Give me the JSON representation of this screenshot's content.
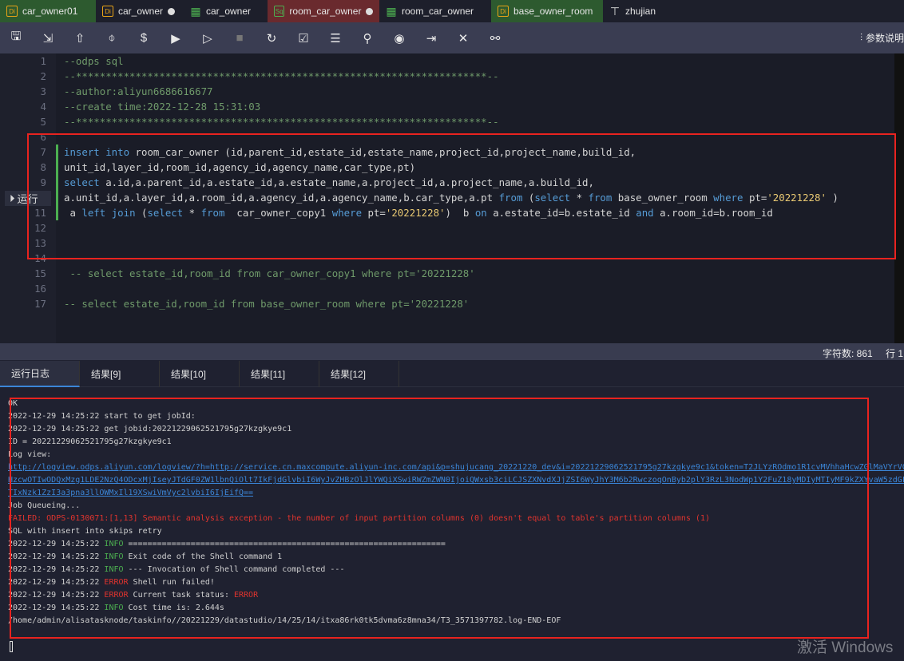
{
  "tabs": [
    {
      "label": "car_owner01",
      "icon": "Di",
      "icon_color": "#e8a317",
      "bg": "#2d5a2f",
      "dot": false
    },
    {
      "label": "car_owner",
      "icon": "Di",
      "icon_color": "#e8a317",
      "bg": "#1d1f2b",
      "dot": true
    },
    {
      "label": "car_owner",
      "icon": "table",
      "icon_color": "#4caf50",
      "bg": "#1d1f2b",
      "dot": false
    },
    {
      "label": "room_car_owner",
      "icon": "Sq",
      "icon_color": "#4caf50",
      "bg": "#6a2a2e",
      "dot": true
    },
    {
      "label": "room_car_owner",
      "icon": "table",
      "icon_color": "#4caf50",
      "bg": "#1d1f2b",
      "dot": false
    },
    {
      "label": "base_owner_room",
      "icon": "Di",
      "icon_color": "#e8a317",
      "bg": "#2d5a2f",
      "dot": false
    },
    {
      "label": "zhujian",
      "icon": "tree",
      "icon_color": "#ddd",
      "bg": "#1d1f2b",
      "dot": false
    }
  ],
  "toolbar": {
    "icons": [
      "save-icon",
      "save-as-icon",
      "submit-icon",
      "format-icon",
      "cost-icon",
      "run-icon",
      "run-params-icon",
      "stop-icon",
      "reload-icon",
      "check-icon",
      "log-icon",
      "user-icon",
      "preview-icon",
      "export-icon",
      "tools-icon",
      "lineage-icon"
    ],
    "params_label": "参数说明"
  },
  "editor": {
    "run_label": "运行",
    "lines": [
      {
        "n": "1",
        "t": [
          [
            "--odps sql",
            "cm"
          ]
        ]
      },
      {
        "n": "2",
        "t": [
          [
            "--*********************************************************************--",
            "cm"
          ]
        ]
      },
      {
        "n": "3",
        "t": [
          [
            "--author:aliyun6686616677",
            "cm"
          ]
        ]
      },
      {
        "n": "4",
        "t": [
          [
            "--create time:2022-12-28 15:31:03",
            "cm"
          ]
        ]
      },
      {
        "n": "5",
        "t": [
          [
            "--*********************************************************************--",
            "cm"
          ]
        ]
      },
      {
        "n": "6",
        "t": []
      },
      {
        "n": "7",
        "t": [
          [
            "insert into",
            "kw"
          ],
          [
            " room_car_owner (id,parent_id,estate_id,estate_name,project_id,project_name,build_id,",
            ""
          ]
        ]
      },
      {
        "n": "8",
        "t": [
          [
            "unit_id,layer_id,room_id,agency_id,agency_name,car_type,pt)",
            ""
          ]
        ]
      },
      {
        "n": "9",
        "t": [
          [
            "select",
            "kw"
          ],
          [
            " a.id,a.parent_id,a.estate_id,a.estate_name,a.project_id,a.project_name,a.build_id,",
            ""
          ]
        ]
      },
      {
        "n": "10",
        "t": [
          [
            "a.unit_id,a.layer_id,a.room_id,a.agency_id,a.agency_name,b.car_type,a.pt ",
            ""
          ],
          [
            "from",
            "kw"
          ],
          [
            " (",
            ""
          ],
          [
            "select",
            "kw"
          ],
          [
            " * ",
            ""
          ],
          [
            "from",
            "kw"
          ],
          [
            " base_owner_room ",
            ""
          ],
          [
            "where",
            "kw"
          ],
          [
            " pt=",
            ""
          ],
          [
            "'20221228'",
            "str"
          ],
          [
            " )",
            ""
          ]
        ]
      },
      {
        "n": "11",
        "t": [
          [
            " a ",
            ""
          ],
          [
            "left join",
            "kw"
          ],
          [
            " (",
            ""
          ],
          [
            "select",
            "kw"
          ],
          [
            " * ",
            ""
          ],
          [
            "from",
            "kw"
          ],
          [
            "  car_owner_copy1 ",
            ""
          ],
          [
            "where",
            "kw"
          ],
          [
            " pt=",
            ""
          ],
          [
            "'20221228'",
            "str"
          ],
          [
            ")  b ",
            ""
          ],
          [
            "on",
            "kw"
          ],
          [
            " a.estate_id=b.estate_id ",
            ""
          ],
          [
            "and",
            "kw"
          ],
          [
            " a.room_id=b.room_id",
            ""
          ]
        ]
      },
      {
        "n": "12",
        "t": []
      },
      {
        "n": "13",
        "t": []
      },
      {
        "n": "14",
        "t": []
      },
      {
        "n": "15",
        "t": [
          [
            " -- select estate_id,room_id from car_owner_copy1 where pt='20221228'",
            "cm"
          ]
        ]
      },
      {
        "n": "16",
        "t": []
      },
      {
        "n": "17",
        "t": [
          [
            "-- select estate_id,room_id from base_owner_room where pt='20221228'",
            "cm"
          ]
        ]
      }
    ]
  },
  "status": {
    "char_count": "字符数: 861",
    "line": "行 1"
  },
  "result_tabs": [
    "运行日志",
    "结果[9]",
    "结果[10]",
    "结果[11]",
    "结果[12]"
  ],
  "log": [
    {
      "parts": [
        [
          "OK",
          ""
        ]
      ]
    },
    {
      "parts": [
        [
          "2022-12-29 14:25:22 start to get jobId:",
          ""
        ]
      ]
    },
    {
      "parts": [
        [
          "2022-12-29 14:25:22 get jobid:20221229062521795g27kzgkye9c1",
          ""
        ]
      ]
    },
    {
      "parts": [
        [
          "ID = 20221229062521795g27kzgkye9c1",
          ""
        ]
      ]
    },
    {
      "parts": [
        [
          "Log view:",
          ""
        ]
      ]
    },
    {
      "parts": [
        [
          "http://logview.odps.aliyun.com/logview/?h=http://service.cn.maxcompute.aliyun-inc.com/api&p=shujucang_20221220_dev&i=20221229062521795g27kzgkye9c1&token=T2JLYzROdmo1R1cvMVhhaHcwZGlMaVYrVG",
          "link"
        ]
      ]
    },
    {
      "parts": [
        [
          "HzcwOTIwODQxMzg1LDE2NzQ4ODcxMjIseyJTdGF0ZW1lbnQiOlt7IkFjdGlvbiI6WyJvZHBzOlJlYWQiXSwiRWZmZWN0IjoiQWxsb3ciLCJSZXNvdXJjZSI6WyJhY3M6b2RwczoqOnByb2plY3RzL3NodWp1Y2FuZ18yMDIyMTIyMF9kZXYvaW5zdGF",
          "link"
        ]
      ]
    },
    {
      "parts": [
        [
          "TIxNzk1ZzI3a3pna3llOWMxIl19XSwiVmVyc2lvbiI6IjEifQ==",
          "link"
        ]
      ]
    },
    {
      "parts": [
        [
          "Job Queueing...",
          ""
        ]
      ]
    },
    {
      "parts": [
        [
          "FAILED: ODPS-0130071:[1,13] Semantic analysis exception - the number of input partition columns (0) doesn't equal to table's partition columns (1)",
          "err"
        ]
      ]
    },
    {
      "parts": [
        [
          "SQL with insert into skips retry",
          ""
        ]
      ]
    },
    {
      "parts": [
        [
          "2022-12-29 14:25:22 ",
          ""
        ],
        [
          "INFO",
          "info"
        ],
        [
          " ==================================================================",
          ""
        ]
      ]
    },
    {
      "parts": [
        [
          "2022-12-29 14:25:22 ",
          ""
        ],
        [
          "INFO",
          "info"
        ],
        [
          " Exit code of the Shell command 1",
          ""
        ]
      ]
    },
    {
      "parts": [
        [
          "2022-12-29 14:25:22 ",
          ""
        ],
        [
          "INFO",
          "info"
        ],
        [
          " --- Invocation of Shell command completed ---",
          ""
        ]
      ]
    },
    {
      "parts": [
        [
          "2022-12-29 14:25:22 ",
          ""
        ],
        [
          "ERROR",
          "err"
        ],
        [
          " Shell run failed!",
          ""
        ]
      ]
    },
    {
      "parts": [
        [
          "2022-12-29 14:25:22 ",
          ""
        ],
        [
          "ERROR",
          "err"
        ],
        [
          " Current task status: ",
          ""
        ],
        [
          "ERROR",
          "err"
        ]
      ]
    },
    {
      "parts": [
        [
          "2022-12-29 14:25:22 ",
          ""
        ],
        [
          "INFO",
          "info"
        ],
        [
          " Cost time is: 2.644s",
          ""
        ]
      ]
    },
    {
      "parts": [
        [
          "/home/admin/alisatasknode/taskinfo//20221229/datastudio/14/25/14/itxa86rk0tk5dvma6z8mna34/T3_3571397782.log-END-EOF",
          ""
        ]
      ]
    }
  ],
  "watermark": "激活 Windows",
  "colors": {
    "highlight_box": "#e8231f",
    "keyword": "#569cd6",
    "string": "#e8c872",
    "comment": "#6f9a6a",
    "link": "#3b86d8",
    "error": "#e0342e",
    "info": "#4caf50"
  }
}
